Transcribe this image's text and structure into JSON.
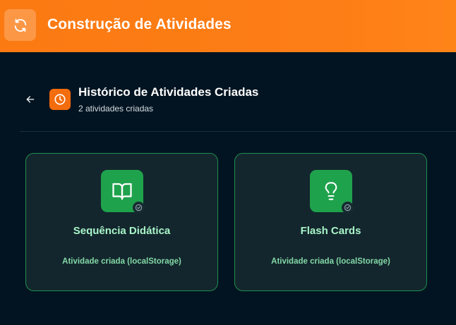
{
  "header": {
    "title": "Construção de Atividades",
    "icon": "refresh-icon",
    "background": "#fb7a12"
  },
  "history": {
    "back_icon": "arrow-left-icon",
    "icon": "clock-icon",
    "icon_color": "#f36c0d",
    "title": "Histórico de Atividades Criadas",
    "subtitle": "2 atividades criadas"
  },
  "activities": [
    {
      "title": "Sequência Didática",
      "status": "Atividade criada (localStorage)",
      "icon": "book-open-icon"
    },
    {
      "title": "Flash Cards",
      "status": "Atividade criada (localStorage)",
      "icon": "lightbulb-icon"
    }
  ],
  "colors": {
    "page_background": "#021421",
    "card_border": "#1f8f4d",
    "card_icon_background": "#1fa24c",
    "card_title": "#a9f5c8"
  }
}
